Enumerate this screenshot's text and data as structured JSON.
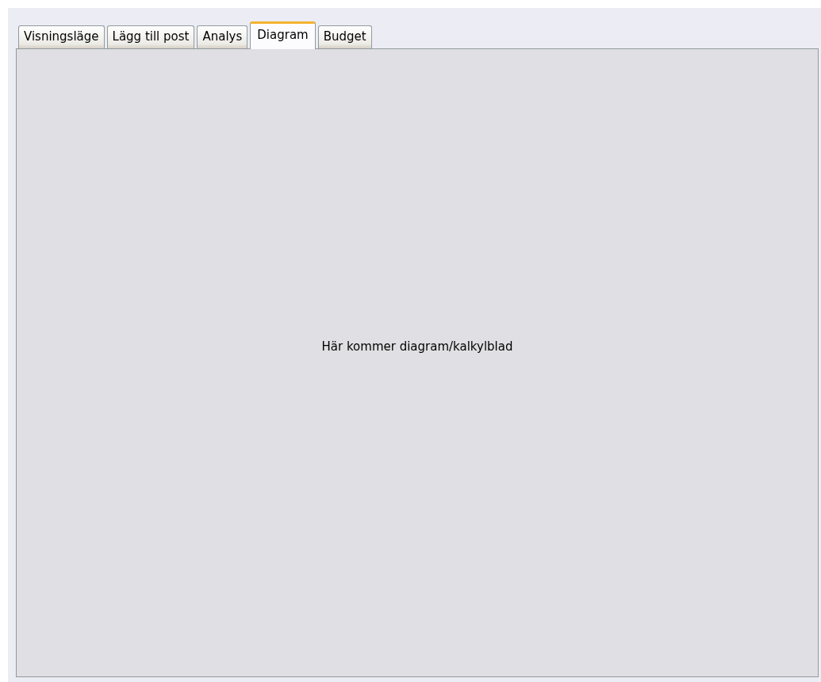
{
  "tabs": [
    {
      "label": "Visningsläge",
      "selected": false
    },
    {
      "label": "Lägg till post",
      "selected": false
    },
    {
      "label": "Analys",
      "selected": false
    },
    {
      "label": "Diagram",
      "selected": true
    },
    {
      "label": "Budget",
      "selected": false
    }
  ],
  "panel": {
    "message": "Här kommer diagram/kalkylblad"
  }
}
